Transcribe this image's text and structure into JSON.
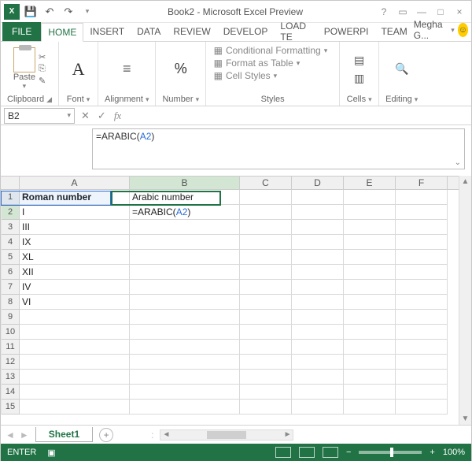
{
  "title": "Book2 - Microsoft Excel Preview",
  "qat": {
    "save": "💾",
    "undo": "↶",
    "redo": "↷"
  },
  "tabs": {
    "file": "FILE",
    "items": [
      "HOME",
      "INSERT",
      "DATA",
      "REVIEW",
      "DEVELOP",
      "LOAD TE",
      "POWERPI",
      "TEAM"
    ],
    "active": 0,
    "user": "Megha G..."
  },
  "ribbon": {
    "clipboard": {
      "paste": "Paste",
      "label": "Clipboard"
    },
    "font": {
      "label": "Font"
    },
    "alignment": {
      "label": "Alignment"
    },
    "number": {
      "label": "Number"
    },
    "styles": {
      "cond": "Conditional Formatting",
      "table": "Format as Table",
      "cell": "Cell Styles",
      "label": "Styles"
    },
    "cells": {
      "label": "Cells"
    },
    "editing": {
      "label": "Editing"
    }
  },
  "namebox": "B2",
  "formula_plain": "=ARABIC(A2)",
  "formula": {
    "pre": "=ARABIC(",
    "ref": "A2",
    "post": ")"
  },
  "columns": [
    "A",
    "B",
    "C",
    "D",
    "E",
    "F"
  ],
  "row_count": 15,
  "headers": {
    "A": "Roman number",
    "B": "Arabic number"
  },
  "dataA": {
    "2": "I",
    "3": "III",
    "4": "IX",
    "5": "XL",
    "6": "XII",
    "7": "IV",
    "8": "VI"
  },
  "active_cell": "B2",
  "referenced_cell": "A2",
  "sheet": {
    "name": "Sheet1"
  },
  "status": {
    "mode": "ENTER",
    "zoom": "100%"
  }
}
